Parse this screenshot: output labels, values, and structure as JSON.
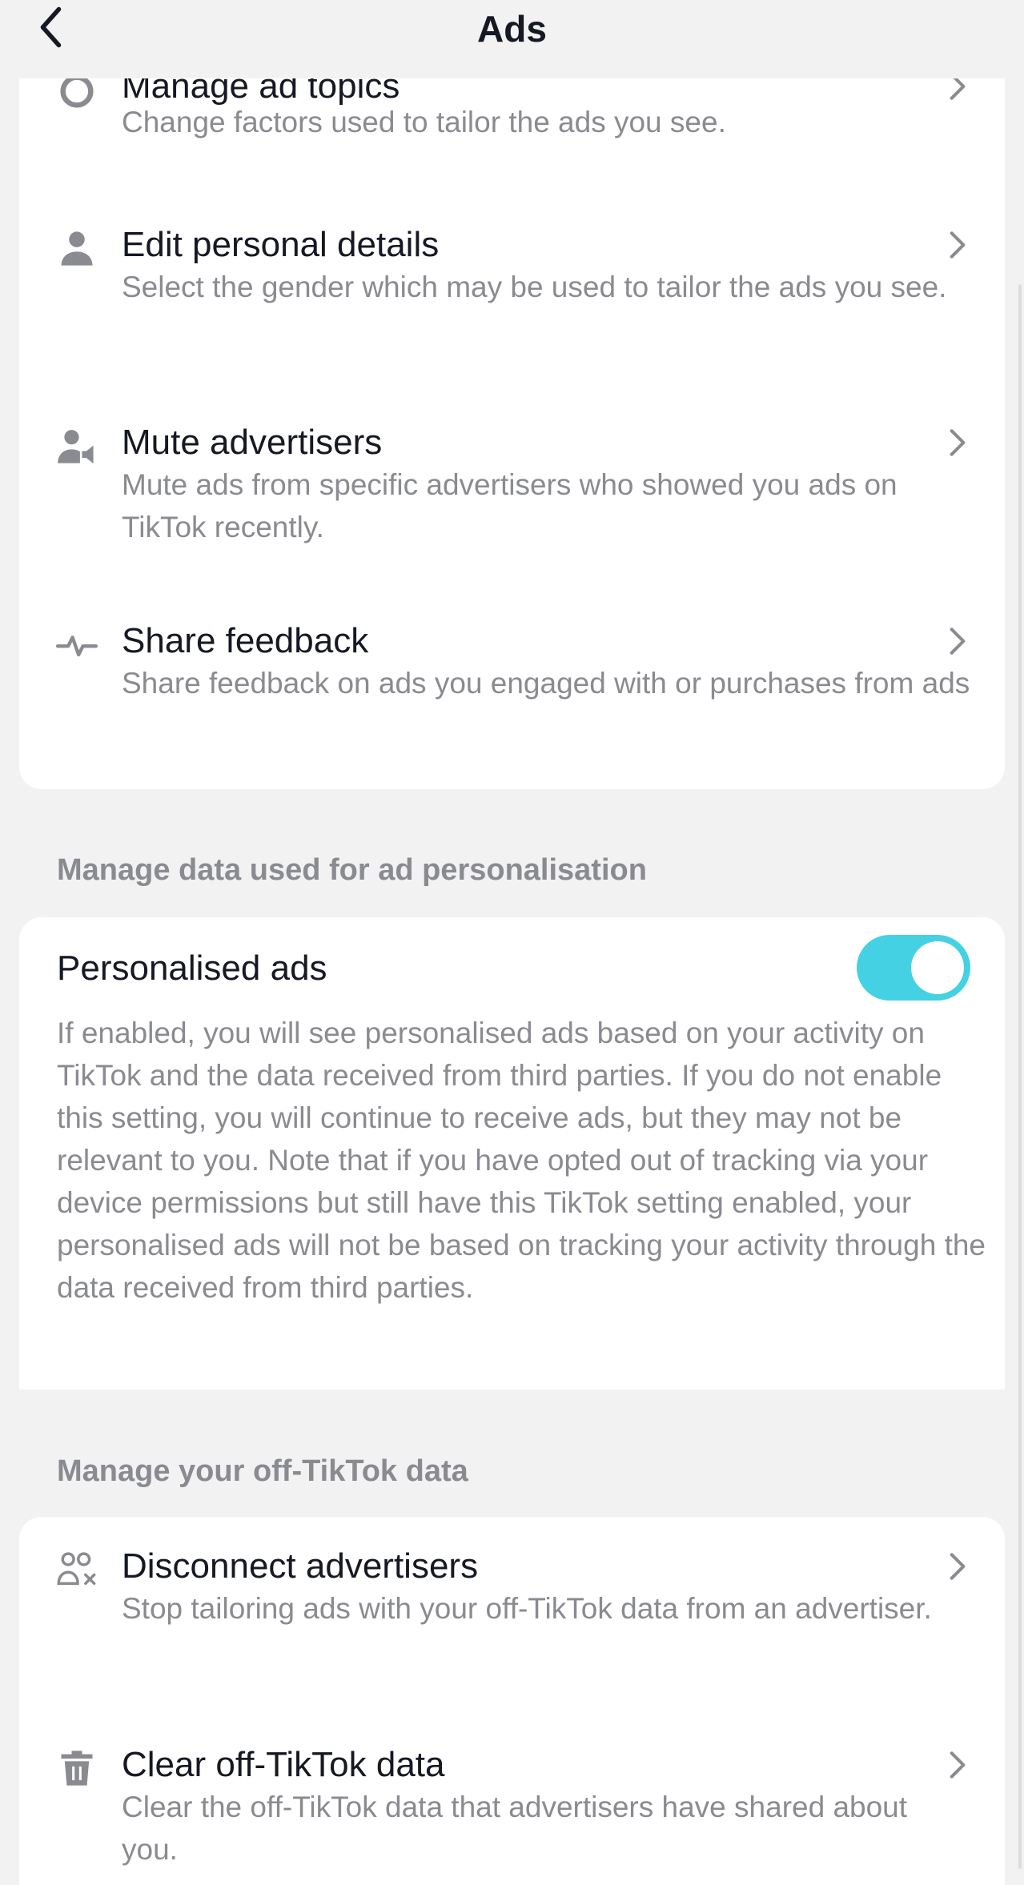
{
  "header": {
    "title": "Ads"
  },
  "ad_settings": [
    {
      "title": "Manage ad topics",
      "desc": "Change factors used to tailor the ads you see.",
      "icon": "manage-topics-icon"
    },
    {
      "title": "Edit personal details",
      "desc": "Select the gender which may be used to tailor the ads you see.",
      "icon": "person-icon"
    },
    {
      "title": "Mute advertisers",
      "desc": "Mute ads from specific advertisers who showed you ads on TikTok recently.",
      "icon": "mute-advertiser-icon"
    },
    {
      "title": "Share feedback",
      "desc": "Share feedback on ads you engaged with or purchases from ads",
      "icon": "pulse-icon"
    }
  ],
  "personalisation": {
    "section_label": "Manage data used for ad personalisation",
    "title": "Personalised ads",
    "enabled": true,
    "toggle_color": "#45d1e4",
    "desc": "If enabled, you will see personalised ads based on your activity on TikTok and the data received from third parties. If you do not enable this setting, you will continue to receive ads, but they may not be relevant to you. Note that if you have opted out of tracking via your device permissions but still have this TikTok setting enabled, your personalised ads will not be based on tracking your activity through the data received from third parties."
  },
  "off_tiktok": {
    "section_label": "Manage your off-TikTok data",
    "items": [
      {
        "title": "Disconnect advertisers",
        "desc": "Stop tailoring ads with your off-TikTok data from an advertiser.",
        "icon": "disconnect-users-icon"
      },
      {
        "title": "Clear off-TikTok data",
        "desc": "Clear the off-TikTok data that advertisers have shared about you.",
        "icon": "trash-icon"
      }
    ]
  }
}
